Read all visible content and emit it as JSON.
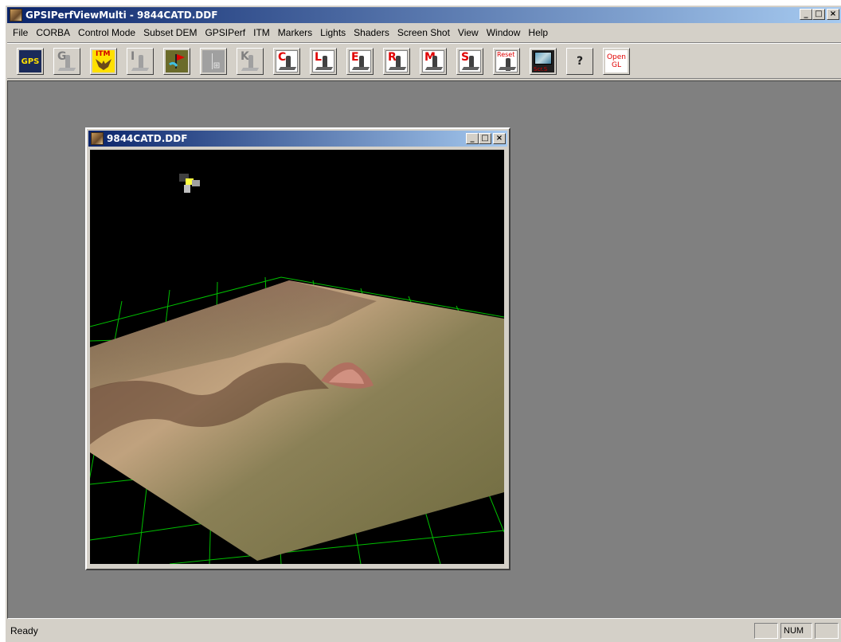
{
  "window": {
    "title": "GPSIPerfViewMulti - 9844CATD.DDF",
    "min": "_",
    "max": "□",
    "close": "×"
  },
  "menu": [
    "File",
    "CORBA",
    "Control Mode",
    "Subset DEM",
    "GPSIPerf",
    "ITM",
    "Markers",
    "Lights",
    "Shaders",
    "Screen Shot",
    "View",
    "Window",
    "Help"
  ],
  "toolbar": {
    "gps_label": "GPS",
    "itm_label": "ITM",
    "g_letter": "G",
    "i_letter": "I",
    "k_letter": "K",
    "c_letter": "C",
    "l_letter": "L",
    "e_letter": "E",
    "r_letter": "R",
    "m_letter": "M",
    "s_letter": "S",
    "reset_label": "Reset",
    "scrs_label": "Scr.S",
    "help_label": "?",
    "opengl_label": "Open GL"
  },
  "child": {
    "title": "9844CATD.DDF",
    "min": "_",
    "max": "□",
    "close": "×"
  },
  "status": {
    "text": "Ready",
    "num": "NUM"
  }
}
